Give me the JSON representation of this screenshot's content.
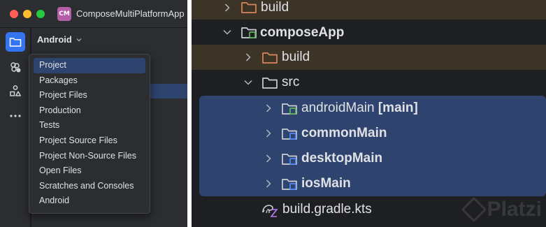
{
  "window": {
    "app_badge": "CM",
    "title": "ComposeMultiPlatformApp"
  },
  "toolstrip": {
    "items": [
      {
        "name": "project",
        "icon": "folder-icon",
        "active": true
      },
      {
        "name": "commit",
        "icon": "commit-icon",
        "active": false
      },
      {
        "name": "structure",
        "icon": "structure-icon",
        "active": false
      },
      {
        "name": "more",
        "icon": "more-icon",
        "active": false
      }
    ]
  },
  "view_selector": {
    "label": "Android"
  },
  "view_menu": {
    "selected": "Project",
    "options": [
      "Project",
      "Packages",
      "Project Files",
      "Production",
      "Tests",
      "Project Source Files",
      "Project Non-Source Files",
      "Open Files",
      "Scratches and Consoles",
      "Android"
    ]
  },
  "tree": {
    "rows": [
      {
        "label": "build",
        "expanded": false,
        "bold": false,
        "icon": "folder-icon"
      },
      {
        "label": "composeApp",
        "expanded": true,
        "bold": true,
        "icon": "module-folder-icon"
      },
      {
        "label": "build",
        "expanded": false,
        "bold": false,
        "icon": "folder-icon"
      },
      {
        "label": "src",
        "expanded": true,
        "bold": false,
        "icon": "folder-icon"
      },
      {
        "label": "androidMain",
        "suffix": "[main]",
        "expanded": false,
        "bold": false,
        "icon": "source-set-icon"
      },
      {
        "label": "commonMain",
        "expanded": false,
        "bold": true,
        "icon": "source-set-icon"
      },
      {
        "label": "desktopMain",
        "expanded": false,
        "bold": true,
        "icon": "source-set-icon"
      },
      {
        "label": "iosMain",
        "expanded": false,
        "bold": true,
        "icon": "source-set-icon"
      },
      {
        "label": "build.gradle.kts",
        "bold": false,
        "icon": "gradle-icon"
      }
    ]
  },
  "watermark": {
    "text": "Platzi"
  },
  "colors": {
    "accent": "#3574f0",
    "selection": "#2e436e",
    "excluded_row": "#3b3427",
    "folder_excluded": "#d9865b",
    "module_badge": "#5fb85a",
    "source_badge": "#548af7"
  }
}
